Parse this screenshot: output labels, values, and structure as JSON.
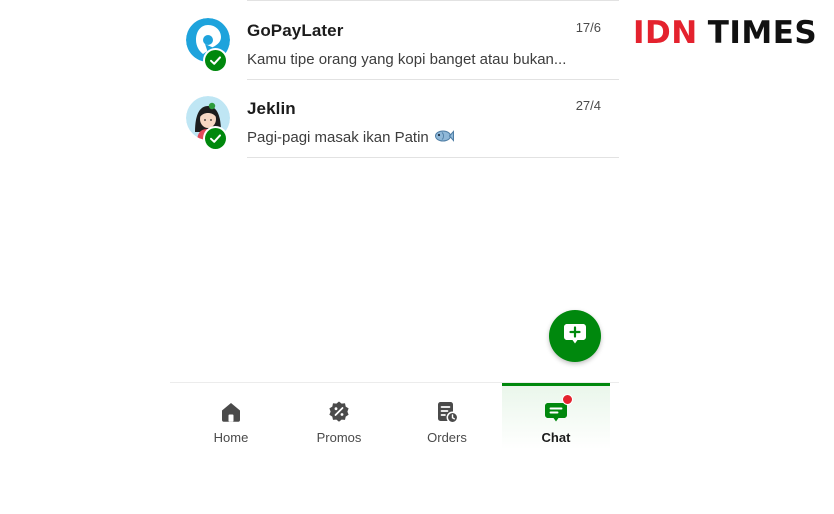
{
  "chats": [
    {
      "name": "GoPayLater",
      "time": "17/6",
      "preview": "Kamu tipe orang yang kopi banget atau bukan...",
      "avatar_icon": "gopaylater-logo-icon",
      "verified": true
    },
    {
      "name": "Jeklin",
      "time": "27/4",
      "preview": "Pagi-pagi masak ikan Patin",
      "preview_emoji_icon": "fish-icon",
      "avatar_icon": "jeklin-avatar-icon",
      "verified": true
    }
  ],
  "fab": {
    "icon": "new-chat-icon"
  },
  "bottom_nav": [
    {
      "label": "Home",
      "icon": "home-icon",
      "active": false
    },
    {
      "label": "Promos",
      "icon": "promo-icon",
      "active": false
    },
    {
      "label": "Orders",
      "icon": "orders-icon",
      "active": false
    },
    {
      "label": "Chat",
      "icon": "chat-icon",
      "active": true,
      "has_notification": true
    }
  ],
  "watermark": {
    "brand_part1": "IDN",
    "brand_part2": "TIMES"
  },
  "colors": {
    "accent_green": "#00880d",
    "brand_red": "#e4222e",
    "gopay_blue": "#1ea3dc"
  }
}
